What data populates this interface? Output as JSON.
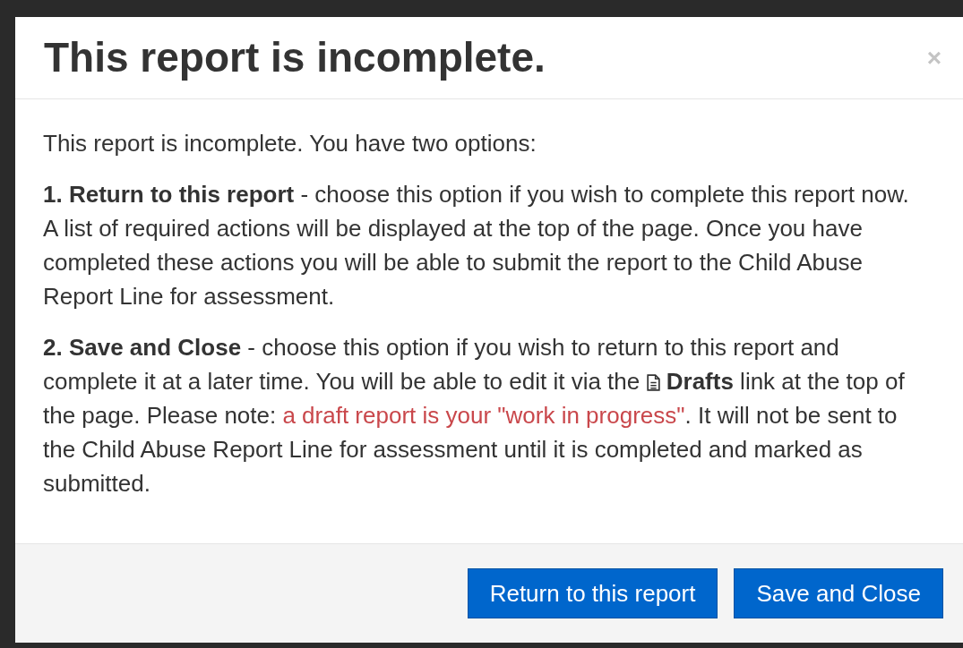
{
  "dialog": {
    "title": "This report is incomplete.",
    "close": "×",
    "paragraphs": [
      {
        "lines": [
          [
            {
              "kind": "text",
              "text": "This report is incomplete. You have two options:"
            }
          ]
        ]
      },
      {
        "lines": [
          [
            {
              "kind": "text",
              "text": "**1. Return to this report** - choose this option if you wish to complete this report now. A list of required actions will be displayed at the top of the page. Once you have completed these actions you will be able to submit the report to the Child Abuse Report Line for assessment."
            }
          ]
        ]
      },
      {
        "lines": [
          [
            {
              "kind": "text",
              "text": "**2. Save and Close** - choose this option if you wish to return to this report and"
            }
          ],
          [
            {
              "kind": "text",
              "text": "complete it at a later time. You will be able to edit it via the"
            },
            {
              "kind": "icon"
            },
            {
              "kind": "text",
              "text": "**Drafts** link at the top of"
            }
          ],
          [
            {
              "kind": "text",
              "text": "the page. Please note:"
            },
            {
              "kind": "warning",
              "text": "a draft report is your \"work in progress\""
            },
            {
              "kind": "text",
              "text": ". It will not be sent to",
              "tight": true
            }
          ],
          [
            {
              "kind": "text",
              "text": "the Child Abuse Report Line for assessment until it is completed and marked as"
            }
          ],
          [
            {
              "kind": "text",
              "text": "submitted."
            }
          ]
        ]
      }
    ],
    "buttons": [
      "Return to this report",
      "Save and Close"
    ]
  }
}
